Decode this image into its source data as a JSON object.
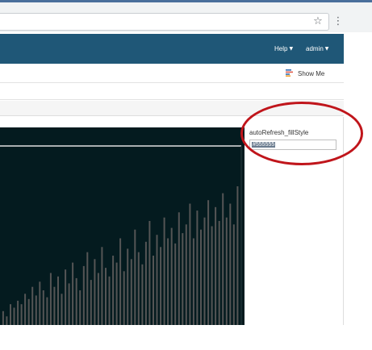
{
  "browser": {
    "star_icon": "star-icon",
    "menu_icon": "kebab-menu-icon",
    "star_glyph": "☆",
    "menu_glyph": "⋮"
  },
  "header": {
    "background": "#1f5777",
    "help_label": "Help",
    "admin_label": "admin",
    "caret": "▼"
  },
  "toolbar": {
    "show_me_label": "Show Me"
  },
  "parameter": {
    "label": "autoRefresh_fillStyle",
    "value": "#555555"
  },
  "visualization": {
    "background": "#041b1f",
    "bar_color": "#555555",
    "line_color": "#e0e0e0",
    "bars": [
      0.08,
      0.05,
      0.12,
      0.1,
      0.14,
      0.12,
      0.18,
      0.15,
      0.22,
      0.17,
      0.25,
      0.2,
      0.16,
      0.3,
      0.22,
      0.28,
      0.18,
      0.32,
      0.24,
      0.36,
      0.27,
      0.2,
      0.34,
      0.42,
      0.26,
      0.38,
      0.3,
      0.45,
      0.33,
      0.28,
      0.4,
      0.36,
      0.5,
      0.31,
      0.44,
      0.38,
      0.55,
      0.42,
      0.35,
      0.48,
      0.6,
      0.4,
      0.52,
      0.45,
      0.62,
      0.5,
      0.56,
      0.47,
      0.65,
      0.53,
      0.58,
      0.7,
      0.5,
      0.66,
      0.55,
      0.62,
      0.72,
      0.57,
      0.68,
      0.6,
      0.76,
      0.62,
      0.7,
      0.58,
      0.8
    ]
  },
  "colors": {
    "highlight": "#c0151b"
  }
}
